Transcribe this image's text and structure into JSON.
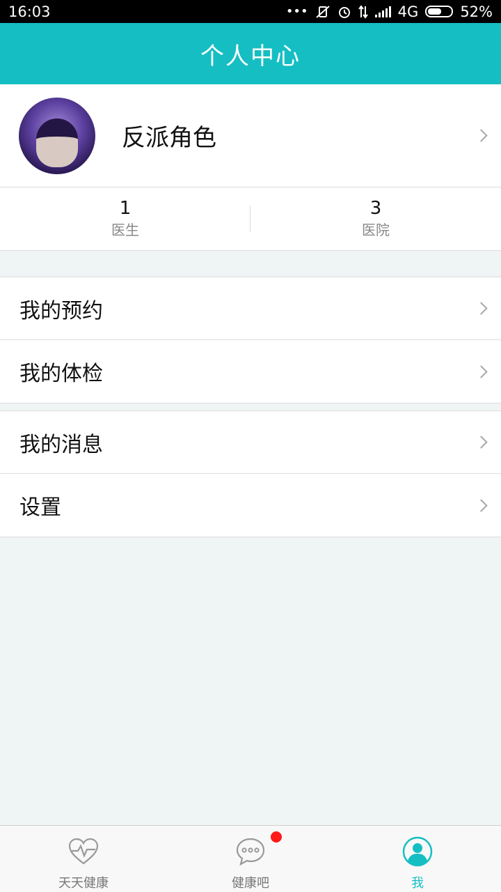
{
  "status_bar": {
    "time": "16:03",
    "network": "4G",
    "battery": "52%"
  },
  "header": {
    "title": "个人中心"
  },
  "profile": {
    "name": "反派角色"
  },
  "stats": [
    {
      "value": "1",
      "label": "医生"
    },
    {
      "value": "3",
      "label": "医院"
    }
  ],
  "menu": {
    "group1": [
      {
        "label": "我的预约"
      },
      {
        "label": "我的体检"
      }
    ],
    "group2": [
      {
        "label": "我的消息"
      },
      {
        "label": "设置"
      }
    ]
  },
  "tabs": [
    {
      "label": "天天健康",
      "icon": "heart-pulse-icon",
      "active": false
    },
    {
      "label": "健康吧",
      "icon": "chat-bubble-icon",
      "active": false,
      "badge": true
    },
    {
      "label": "我",
      "icon": "user-icon",
      "active": true
    }
  ],
  "colors": {
    "accent": "#15bec3",
    "background": "#eff4f5",
    "badge": "#ff1a1a"
  }
}
